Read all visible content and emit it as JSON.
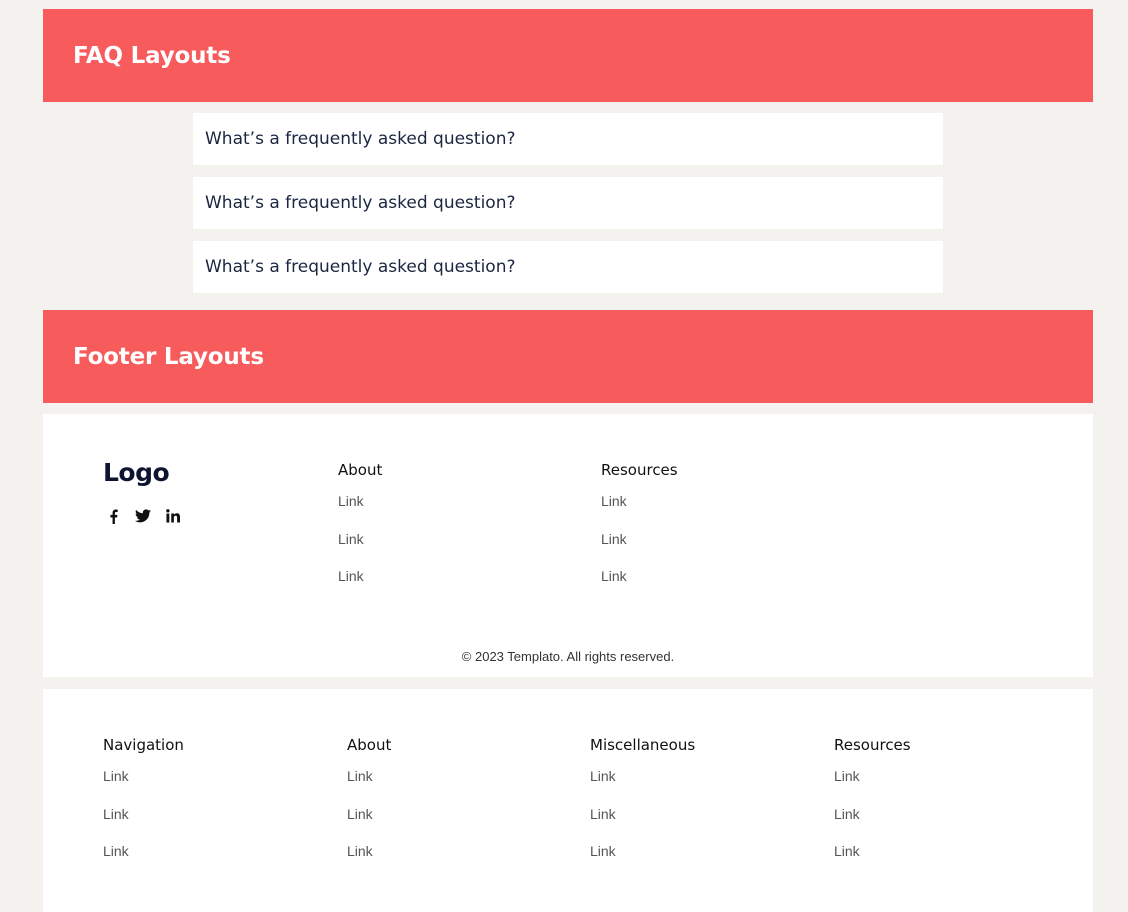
{
  "faq_section": {
    "title": "FAQ Layouts",
    "questions": [
      "What’s a frequently asked question?",
      "What’s a frequently asked question?",
      "What’s a frequently asked question?"
    ]
  },
  "footer_section": {
    "title": "Footer Layouts"
  },
  "footer_one": {
    "logo": "Logo",
    "socials": [
      "facebook-icon",
      "twitter-icon",
      "linkedin-icon"
    ],
    "columns": [
      {
        "heading": "About",
        "links": [
          "Link",
          "Link",
          "Link"
        ]
      },
      {
        "heading": "Resources",
        "links": [
          "Link",
          "Link",
          "Link"
        ]
      }
    ],
    "copyright": "© 2023 Templato. All rights reserved."
  },
  "footer_two": {
    "columns": [
      {
        "heading": "Navigation",
        "links": [
          "Link",
          "Link",
          "Link"
        ]
      },
      {
        "heading": "About",
        "links": [
          "Link",
          "Link",
          "Link"
        ]
      },
      {
        "heading": "Miscellaneous",
        "links": [
          "Link",
          "Link",
          "Link"
        ]
      },
      {
        "heading": "Resources",
        "links": [
          "Link",
          "Link",
          "Link"
        ]
      }
    ]
  },
  "colors": {
    "accent": "#f75b5c",
    "background": "#f3f2ee",
    "card": "#ffffff",
    "heading_text": "#1b2640"
  }
}
